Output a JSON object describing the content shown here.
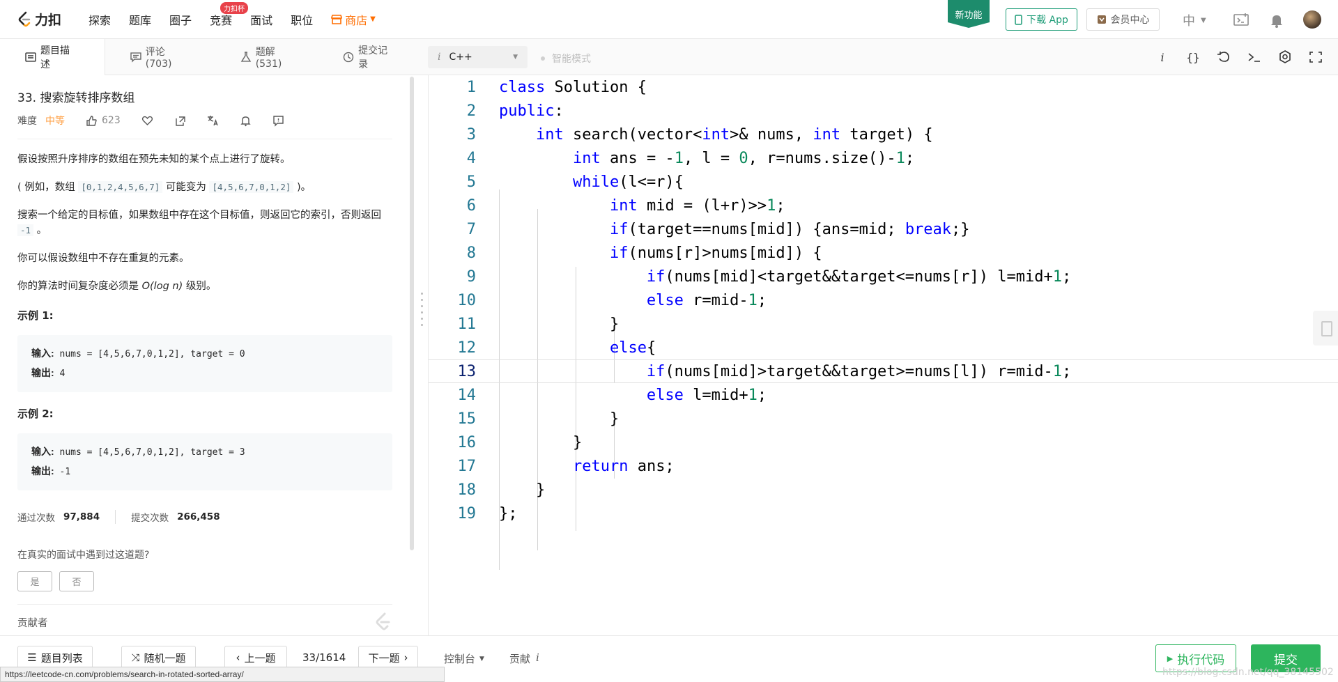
{
  "nav": {
    "logo_text": "力扣",
    "items": [
      "探索",
      "题库",
      "圈子",
      "竞赛",
      "面试",
      "职位"
    ],
    "contest_badge": "力扣杯",
    "store": "商店",
    "new_feature": "新功能",
    "download": "下载 App",
    "member": "会员中心",
    "lang": "中",
    "accent": "#1d9c77"
  },
  "left_tabs": {
    "description": "题目描述",
    "comments": "评论 (703)",
    "solutions": "题解(531)",
    "submissions": "提交记录"
  },
  "problem": {
    "title": "33. 搜索旋转排序数组",
    "difficulty_label": "难度",
    "difficulty": "中等",
    "likes": "623",
    "para1": "假设按照升序排序的数组在预先未知的某个点上进行了旋转。",
    "para2_pre": "( 例如，数组 ",
    "para2_code1": "[0,1,2,4,5,6,7]",
    "para2_mid": " 可能变为 ",
    "para2_code2": "[4,5,6,7,0,1,2]",
    "para2_post": " )。",
    "para3_pre": "搜索一个给定的目标值，如果数组中存在这个目标值，则返回它的索引，否则返回 ",
    "para3_code": "-1",
    "para3_post": " 。",
    "para4": "你可以假设数组中不存在重复的元素。",
    "para5_pre": "你的算法时间复杂度必须是 ",
    "para5_math": "O(log n)",
    "para5_post": " 级别。",
    "example1_title": "示例 1:",
    "example1_input_label": "输入:",
    "example1_input": " nums = [4,5,6,7,0,1,2], target = 0",
    "example1_output_label": "输出:",
    "example1_output": " 4",
    "example2_title": "示例 2:",
    "example2_input_label": "输入:",
    "example2_input": " nums = [4,5,6,7,0,1,2], target = 3",
    "example2_output_label": "输出:",
    "example2_output": " -1",
    "accepted_label": "通过次数",
    "accepted": "97,884",
    "submitted_label": "提交次数",
    "submitted": "266,458",
    "interview_q": "在真实的面试中遇到过这道题?",
    "yes": "是",
    "no": "否",
    "contributors": "贡献者"
  },
  "editor": {
    "language": "C++",
    "smart_mode": "智能模式",
    "lines": [
      "1",
      "2",
      "3",
      "4",
      "5",
      "6",
      "7",
      "8",
      "9",
      "10",
      "11",
      "12",
      "13",
      "14",
      "15",
      "16",
      "17",
      "18",
      "19"
    ],
    "current_line": 13
  },
  "bottom": {
    "problem_list": "题目列表",
    "random": "随机一题",
    "prev": "上一题",
    "page": "33/1614",
    "next": "下一题",
    "console": "控制台",
    "contribute": "贡献",
    "run": "执行代码",
    "submit": "提交"
  },
  "status_url": "https://leetcode-cn.com/problems/search-in-rotated-sorted-array/",
  "watermark": "https://blog.csdn.net/qq_38145502"
}
